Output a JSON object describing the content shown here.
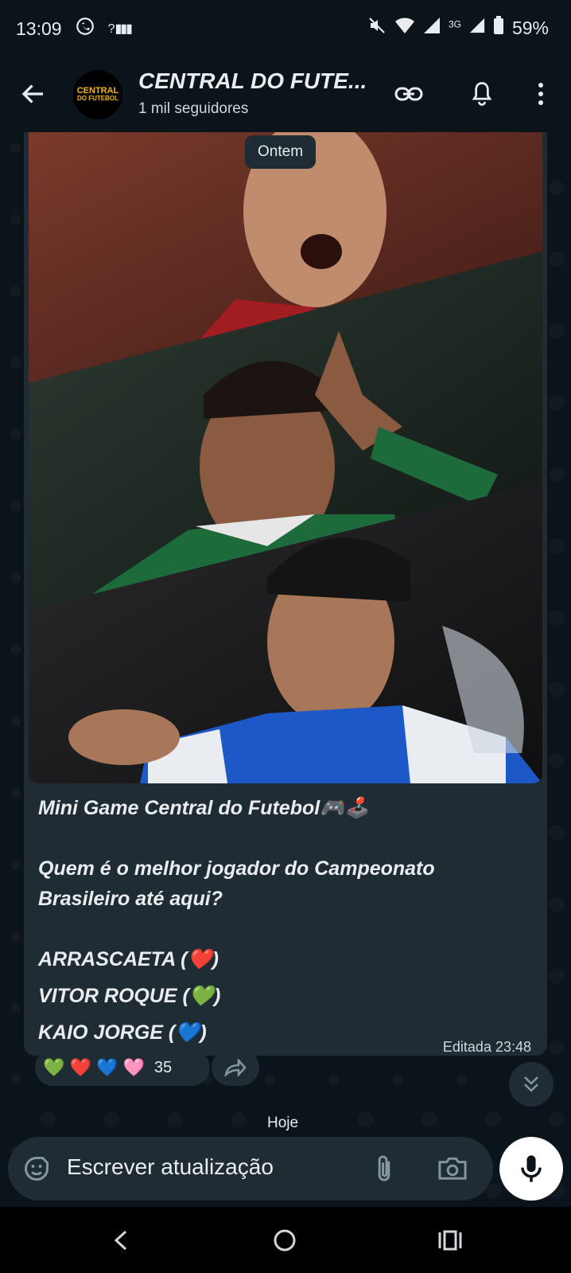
{
  "status_bar": {
    "time": "13:09",
    "network": "3G",
    "battery": "59%"
  },
  "header": {
    "channel_name": "CENTRAL DO FUTE...",
    "subtitle": "1 mil seguidores",
    "avatar_text_line1": "CENTRAL",
    "avatar_text_line2": "DO FUTEBOL"
  },
  "chat": {
    "date_chip": "Ontem",
    "message": {
      "line1": "Mini Game Central do Futebol🎮🕹️",
      "line2": "Quem é o melhor jogador do Campeonato Brasileiro até aqui?",
      "option1": "ARRASCAETA (❤️)",
      "option2": "VITOR ROQUE  (💚)",
      "option3": "KAIO JORGE (💙)",
      "time": "Editada 23:48"
    },
    "reactions": {
      "emojis": "💚 ❤️ 💙 🩷",
      "count": "35"
    },
    "today_chip": "Hoje"
  },
  "composer": {
    "placeholder": "Escrever atualização"
  },
  "colors": {
    "background": "#0b141a",
    "bubble": "#1f2c33",
    "text": "#e9edef"
  }
}
